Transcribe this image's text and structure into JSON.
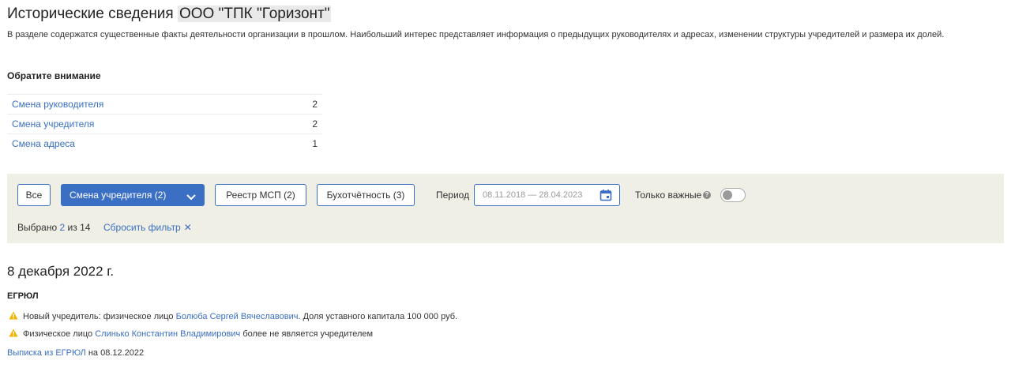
{
  "header": {
    "title": "Исторические сведения",
    "org_name": "ООО \"ТПК \"Горизонт\"",
    "description": "В разделе содержатся существенные факты деятельности организации в прошлом. Наибольший интерес представляет информация о предыдущих руководителях и адресах, изменении структуры учредителей и размера их долей."
  },
  "attention": {
    "heading": "Обратите внимание",
    "items": [
      {
        "label": "Смена руководителя",
        "count": "2"
      },
      {
        "label": "Смена учредителя",
        "count": "2"
      },
      {
        "label": "Смена адреса",
        "count": "1"
      }
    ]
  },
  "filters": {
    "all_label": "Все",
    "founder_change_label": "Смена учредителя (2)",
    "msp_registry_label": "Реестр МСП (2)",
    "accounting_label": "Бухотчётность (3)",
    "period_label": "Период",
    "period_value": "08.11.2018 — 28.04.2023",
    "only_important_label": "Только важные",
    "only_important_on": false,
    "selected_prefix": "Выбрано",
    "selected_count": "2",
    "selected_suffix": "из 14",
    "reset_label": "Сбросить фильтр"
  },
  "timeline": {
    "date": "8 декабря 2022 г.",
    "source": "ЕГРЮЛ",
    "events": [
      {
        "prefix": "Новый учредитель: физическое лицо",
        "person": "Болюба Сергей Вячеславович",
        "suffix": ". Доля уставного капитала 100 000 руб."
      },
      {
        "prefix": "Физическое лицо",
        "person": "Слинько Константин Владимирович",
        "suffix": "более не является учредителем"
      }
    ],
    "extract_link": "Выписка из ЕГРЮЛ",
    "extract_suffix": "на 08.12.2022"
  },
  "colors": {
    "accent": "#3a6fc4",
    "filter_bg": "#efefe5",
    "warning": "#f0b400"
  }
}
